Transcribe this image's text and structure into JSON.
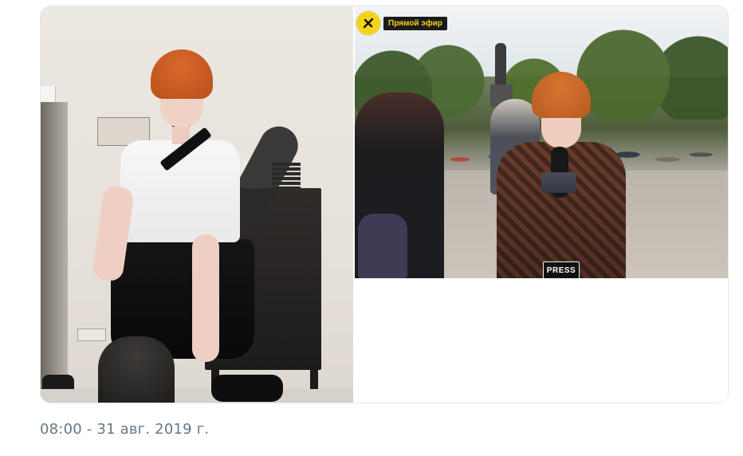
{
  "tweet": {
    "timestamp": "08:00 - 31 авг. 2019 г."
  },
  "media": {
    "left_photo": {
      "description_icon": "photo-icon"
    },
    "right_photo": {
      "live_label": "Прямой эфир",
      "press_badge": "PRESS",
      "logo_icon": "lightning-icon"
    }
  },
  "colors": {
    "timestamp": "#657786",
    "live_logo": "#f4d31a",
    "live_label_bg": "#1b1b1b",
    "card_border": "#e1e8ed"
  }
}
